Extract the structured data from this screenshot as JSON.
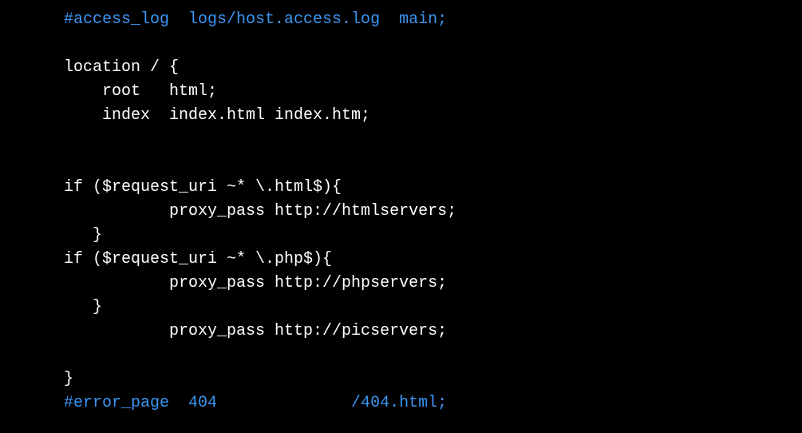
{
  "code": {
    "lines": [
      {
        "type": "comment",
        "text": "#access_log  logs/host.access.log  main;"
      },
      {
        "type": "blank",
        "text": ""
      },
      {
        "type": "text",
        "text": "location / {"
      },
      {
        "type": "text",
        "text": "    root   html;"
      },
      {
        "type": "text",
        "text": "    index  index.html index.htm;"
      },
      {
        "type": "blank",
        "text": ""
      },
      {
        "type": "blank",
        "text": ""
      },
      {
        "type": "text",
        "text": "if ($request_uri ~* \\.html$){"
      },
      {
        "type": "text",
        "text": "           proxy_pass http://htmlservers;"
      },
      {
        "type": "text",
        "text": "   }"
      },
      {
        "type": "text",
        "text": "if ($request_uri ~* \\.php$){"
      },
      {
        "type": "text",
        "text": "           proxy_pass http://phpservers;"
      },
      {
        "type": "text",
        "text": "   }"
      },
      {
        "type": "text",
        "text": "           proxy_pass http://picservers;"
      },
      {
        "type": "blank",
        "text": ""
      },
      {
        "type": "text",
        "text": "}"
      },
      {
        "type": "comment",
        "text": "#error_page  404              /404.html;"
      }
    ]
  }
}
